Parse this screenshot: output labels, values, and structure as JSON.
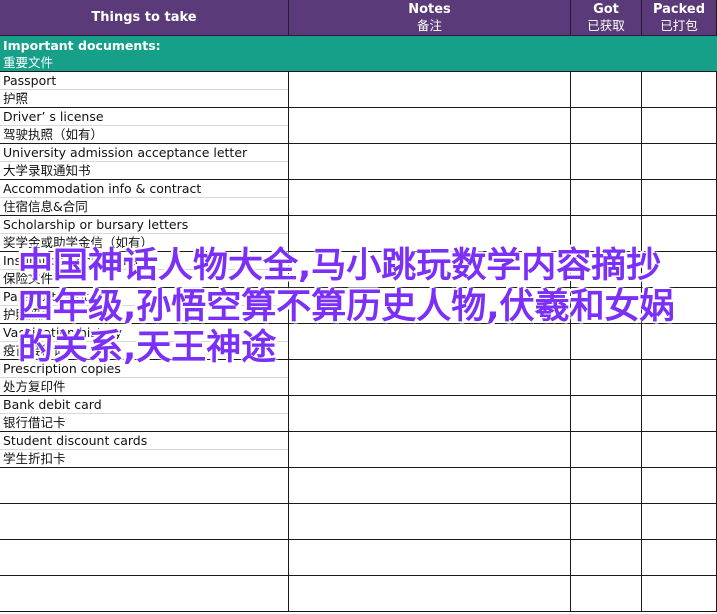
{
  "header": {
    "col1": "Things to take",
    "col2": "Notes",
    "col2_cn": "备注",
    "col3": "Got",
    "col3_cn": "已获取",
    "col4": "Packed",
    "col4_cn": "已打包"
  },
  "section": {
    "en": "Important documents:",
    "cn": "重要文件"
  },
  "items": [
    {
      "en": "Passport",
      "cn": "护照"
    },
    {
      "en": "Driver’ s license",
      "cn": "驾驶执照（如有）"
    },
    {
      "en": "University admission acceptance letter",
      "cn": "大学录取通知书"
    },
    {
      "en": "Accommodation info & contract",
      "cn": "住宿信息&合同"
    },
    {
      "en": "Scholarship or bursary letters",
      "cn": "奖学金或助学金信（如有）"
    },
    {
      "en": "Insurance documents",
      "cn": "保险文件"
    },
    {
      "en": "Passport photos",
      "cn": "护照照片"
    },
    {
      "en": "Vaccination history",
      "cn": "疫苗接种记录"
    },
    {
      "en": "Prescription copies",
      "cn": "处方复印件"
    },
    {
      "en": "Bank debit card",
      "cn": "银行借记卡"
    },
    {
      "en": "Student discount cards",
      "cn": "学生折扣卡"
    }
  ],
  "overlay_text": "中国神话人物大全,马小跳玩数学内容摘抄四年级,孙悟空算不算历史人物,伏羲和女娲的关系,天王神途",
  "colors": {
    "header_bg": "#5a3a78",
    "section_bg": "#16a08a",
    "overlay_text": "#7b2ff7"
  }
}
